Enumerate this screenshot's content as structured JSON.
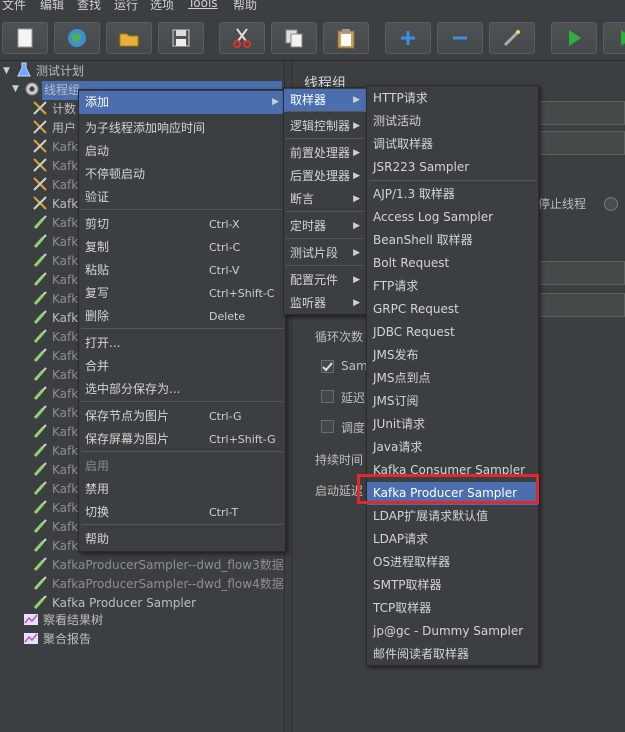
{
  "menubar": {
    "items": [
      "文件",
      "编辑",
      "查找",
      "运行",
      "选项",
      "Tools",
      "帮助"
    ]
  },
  "toolbar": {
    "buttons": [
      "new-icon",
      "open-templates-icon",
      "open-icon",
      "save-icon",
      "cut-icon",
      "copy-icon",
      "paste-icon",
      "expand-icon",
      "collapse-icon",
      "toggle-icon",
      "start-icon",
      "start-no-pause-icon"
    ]
  },
  "tree": {
    "root": "测试计划",
    "thread_group": "线程组",
    "children": [
      "计数",
      "用户",
      "Kafk",
      "Kafk",
      "Kafk",
      "Kafk",
      "Kafk",
      "Kafk",
      "Kafk",
      "Kafk",
      "Kafk",
      "Kafk",
      "Kafk",
      "Kafk",
      "Kafk",
      "Kafk",
      "Kafk",
      "Kafk",
      "Kafk",
      "Kafk",
      "Kafk",
      "Kafk",
      "Kafk",
      "Kafk"
    ],
    "full_items": [
      "KafkaProducerSampler--dwd_flow3数据",
      "KafkaProducerSampler--dwd_flow4数据",
      "Kafka Producer Sampler"
    ],
    "listeners": [
      "察看结果树",
      "聚合报告"
    ]
  },
  "right_panel": {
    "title": "线程组",
    "stop_thread": "停止线程",
    "loop_count": "循环次数",
    "same_user": "Sam",
    "delay": "延迟",
    "scheduler": "调度",
    "duration": "持续时间",
    "startup_delay": "启动延迟"
  },
  "context_menu": {
    "items": [
      {
        "label": "添加",
        "shortcut": "",
        "submenu": true,
        "selected": true
      },
      {
        "label": "为子线程添加响应时间",
        "shortcut": ""
      },
      {
        "label": "启动",
        "shortcut": ""
      },
      {
        "label": "不停顿启动",
        "shortcut": ""
      },
      {
        "label": "验证",
        "shortcut": ""
      },
      {
        "label": "剪切",
        "shortcut": "Ctrl-X"
      },
      {
        "label": "复制",
        "shortcut": "Ctrl-C"
      },
      {
        "label": "粘贴",
        "shortcut": "Ctrl-V"
      },
      {
        "label": "复写",
        "shortcut": "Ctrl+Shift-C"
      },
      {
        "label": "删除",
        "shortcut": "Delete"
      },
      {
        "label": "打开...",
        "shortcut": ""
      },
      {
        "label": "合并",
        "shortcut": ""
      },
      {
        "label": "选中部分保存为...",
        "shortcut": ""
      },
      {
        "label": "保存节点为图片",
        "shortcut": "Ctrl-G"
      },
      {
        "label": "保存屏幕为图片",
        "shortcut": "Ctrl+Shift-G"
      },
      {
        "label": "启用",
        "shortcut": "",
        "disabled": true
      },
      {
        "label": "禁用",
        "shortcut": ""
      },
      {
        "label": "切换",
        "shortcut": "Ctrl-T"
      },
      {
        "label": "帮助",
        "shortcut": ""
      }
    ]
  },
  "add_menu": {
    "items": [
      "取样器",
      "逻辑控制器",
      "前置处理器",
      "后置处理器",
      "断言",
      "定时器",
      "测试片段",
      "配置元件",
      "监听器"
    ]
  },
  "sampler_menu": {
    "items": [
      "HTTP请求",
      "测试活动",
      "调试取样器",
      "JSR223 Sampler",
      "AJP/1.3 取样器",
      "Access Log Sampler",
      "BeanShell 取样器",
      "Bolt Request",
      "FTP请求",
      "GRPC Request",
      "JDBC Request",
      "JMS发布",
      "JMS点到点",
      "JMS订阅",
      "JUnit请求",
      "Java请求",
      "Kafka Consumer Sampler",
      "Kafka Producer Sampler",
      "LDAP扩展请求默认值",
      "LDAP请求",
      "OS进程取样器",
      "SMTP取样器",
      "TCP取样器",
      "jp@gc - Dummy Sampler",
      "邮件阅读者取样器"
    ],
    "selected": "Kafka Producer Sampler"
  },
  "colors": {
    "background": "#3c3f41",
    "selection": "#4b6eaf",
    "highlight_box": "#e0292e"
  }
}
